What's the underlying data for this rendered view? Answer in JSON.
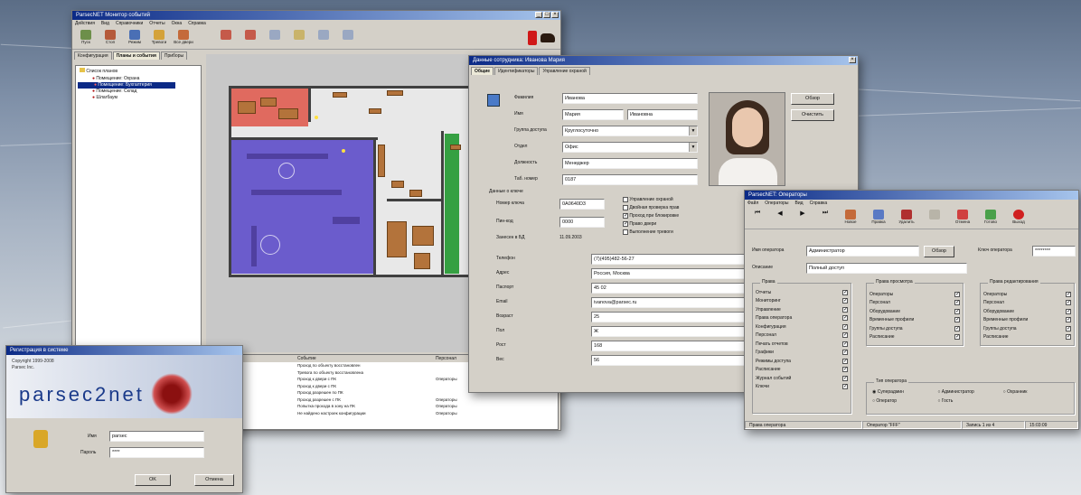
{
  "mainwin": {
    "title": "ParsecNET Монитор событий",
    "menu": [
      "Действия",
      "Вид",
      "Справочники",
      "Отчеты",
      "Окна",
      "Справка"
    ],
    "tools": [
      "Пуск",
      "Стоп",
      "Режим",
      "Тревоги",
      "Все двери",
      "",
      ""
    ],
    "tabs": [
      "Конфигурация",
      "Планы и события",
      "Приборы"
    ],
    "tree_root": "Список планов",
    "tree_items": [
      "Помещение: Охрана",
      "Помещение: Бухгалтерия",
      "Помещение: Склад",
      "Шлагбаум"
    ],
    "events_header": [
      "Событие",
      "Персонал"
    ],
    "events": [
      [
        "Проход по объекту восстановлен",
        ""
      ],
      [
        "Тревога по объекту восстановлена",
        ""
      ],
      [
        "Проход к двери с ПК",
        "Операторы"
      ],
      [
        "Проход к двери с ПК",
        ""
      ],
      [
        "Проход разрешен по ПК",
        ""
      ],
      [
        "Проход разрешен с ПК",
        "Операторы"
      ],
      [
        "Попытка прохода в зону на ПК",
        "Операторы"
      ],
      [
        "Не найдено настроек конфигурации",
        "Операторы"
      ]
    ]
  },
  "personwin": {
    "title": "Данные сотрудника: Иванова Мария",
    "tabs": [
      "Общие",
      "Идентификаторы",
      "Управление охраной"
    ],
    "labels": {
      "surname": "Фамилия",
      "name": "Имя",
      "group": "Группа доступа",
      "dept": "Отдел",
      "position": "Должность",
      "tab": "Таб. номер",
      "card_title": "Данные о ключе",
      "card_no": "Номер ключа",
      "pin": "Пин-код",
      "added": "Занесен в БД",
      "phone": "Телефон",
      "address": "Адрес",
      "pass": "Паспорт",
      "email": "Email",
      "b1": "Возраст",
      "b2": "Пол",
      "b3": "Рост",
      "b4": "Вес"
    },
    "values": {
      "surname": "Иванова",
      "name": "Мария",
      "patronymic": "Ивановна",
      "group": "Круглосуточно",
      "dept": "Офис",
      "position": "Менеджер",
      "tab": "0187",
      "card_no": "0A0640D3",
      "pin": "0000",
      "added": "11.09.2003",
      "phone": "(7)(495)482-56-27",
      "address": "Россия, Москва",
      "pass": "45 02",
      "email": "ivanova@parsec.ru",
      "b1": "25",
      "b2": "Ж",
      "b3": "168",
      "b4": "56"
    },
    "checks": [
      "Управление охраной",
      "Двойная проверка прав",
      "Проход при блокировке",
      "Право двери",
      "Выполнение тревоги"
    ],
    "buttons": [
      "Обзор",
      "Очистить"
    ]
  },
  "operwin": {
    "title": "ParsecNET: Операторы",
    "menu": [
      "Файл",
      "Операторы",
      "Вид",
      "Справка"
    ],
    "tools": [
      "",
      "",
      "",
      "",
      "Новое",
      "Правка",
      "Удалить",
      "",
      "Отмена",
      "Готово",
      "Выход"
    ],
    "labels": {
      "opname": "Имя оператора",
      "desc": "Описание",
      "pwd": "Ключ оператора"
    },
    "values": {
      "opname": "Администратор",
      "desc": "Полный доступ",
      "pwd": "********"
    },
    "browse": "Обзор",
    "g1": {
      "title": "Права",
      "items": [
        "Отчеты",
        "Мониторинг",
        "Управление",
        "Права оператора",
        "Конфигурация",
        "Персонал",
        "Печать отчетов",
        "Графики",
        "Режимы доступа",
        "Расписание",
        "Журнал событий",
        "Ключи"
      ]
    },
    "g2": {
      "title": "Права просмотра",
      "items": [
        "Операторы",
        "Персонал",
        "Оборудование",
        "Временные профили",
        "Группы доступа",
        "Расписание"
      ]
    },
    "g3": {
      "title": "Права редактирования",
      "items": [
        "Операторы",
        "Персонал",
        "Оборудование",
        "Временные профили",
        "Группы доступа",
        "Расписание"
      ]
    },
    "g4": {
      "title": "Тип оператора",
      "items": [
        "Суперадмин",
        "Администратор",
        "Охранник",
        "Оператор",
        "Гость",
        ""
      ]
    },
    "status": [
      "Права оператора",
      "Оператор \"FFF\"",
      "Запись 1 из 4",
      "15:03:09"
    ]
  },
  "loginwin": {
    "title": "Регистрация в системе",
    "copyright": "Copyright 1999-2008",
    "company": "Parsec Inc.",
    "logo": "parsec2net",
    "user_label": "Имя",
    "user_value": "parsec",
    "pass_label": "Пароль",
    "pass_value": "****",
    "ok": "OK",
    "cancel": "Отмена"
  },
  "colors": {
    "titlebar": "#0b2a86",
    "plan_blue": "#6b5ccc",
    "plan_red": "#e06a5f",
    "plan_green": "#35a042"
  },
  "icons": [
    "app-icon",
    "window-buttons",
    "user-icon",
    "keys-icon",
    "siren-icon",
    "dog-icon",
    "tree-folder-icon"
  ]
}
